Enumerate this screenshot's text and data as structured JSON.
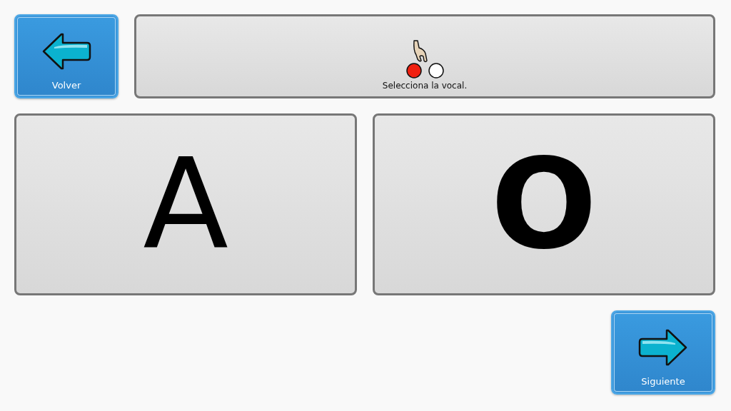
{
  "back_button": {
    "label": "Volver"
  },
  "instruction": {
    "text": "Selecciona la vocal."
  },
  "options": [
    {
      "label": "A",
      "bold": false
    },
    {
      "label": "O",
      "bold": true
    }
  ],
  "next_button": {
    "label": "Siguiente"
  }
}
